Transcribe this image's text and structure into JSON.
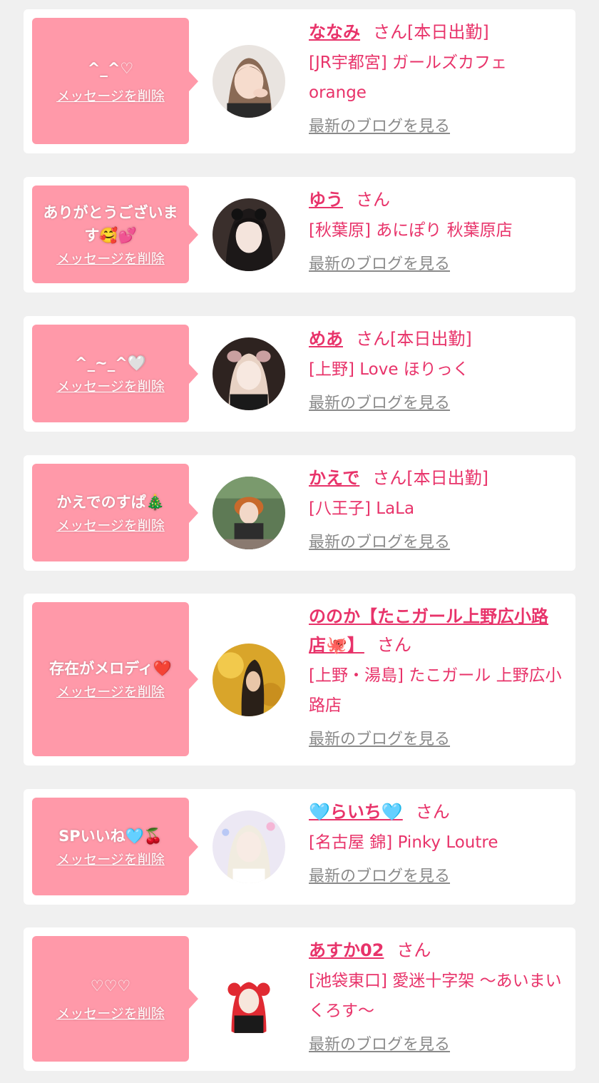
{
  "delete_label": "メッセージを削除",
  "blog_label": "最新のブログを見る",
  "honorific": "さん",
  "colors": {
    "accent": "#e8336a",
    "bubble": "#ff99a9",
    "card": "#ffffff",
    "page": "#f0f0f0",
    "link_gray": "#8a8a8a"
  },
  "entries": [
    {
      "message": "^_^♡",
      "name": "ななみ",
      "status": "[本日出勤]",
      "shop": "[JR宇都宮] ガールズカフェ orange"
    },
    {
      "message": "ありがとうございます🥰💕",
      "name": "ゆう",
      "status": "",
      "shop": "[秋葉原] あにぽり 秋葉原店"
    },
    {
      "message": "^_~_^🤍",
      "name": "めあ",
      "status": "[本日出勤]",
      "shop": "[上野] Love ほりっく"
    },
    {
      "message": "かえでのすぱ🎄",
      "name": "かえで",
      "status": "[本日出勤]",
      "shop": "[八王子] LaLa"
    },
    {
      "message": "存在がメロディ❤️",
      "name": "ののか【たこガール上野広小路店🐙】",
      "status": "",
      "shop": "[上野・湯島] たこガール 上野広小路店"
    },
    {
      "message": "SPいいね🩵🍒",
      "name": "🩵らいち🩵",
      "status": "",
      "shop": "[名古屋 錦] Pinky Loutre"
    },
    {
      "message": "♡♡♡",
      "name": "あすか02",
      "status": "",
      "shop": "[池袋東口] 愛迷十字架 〜あいまいくろす〜"
    }
  ]
}
